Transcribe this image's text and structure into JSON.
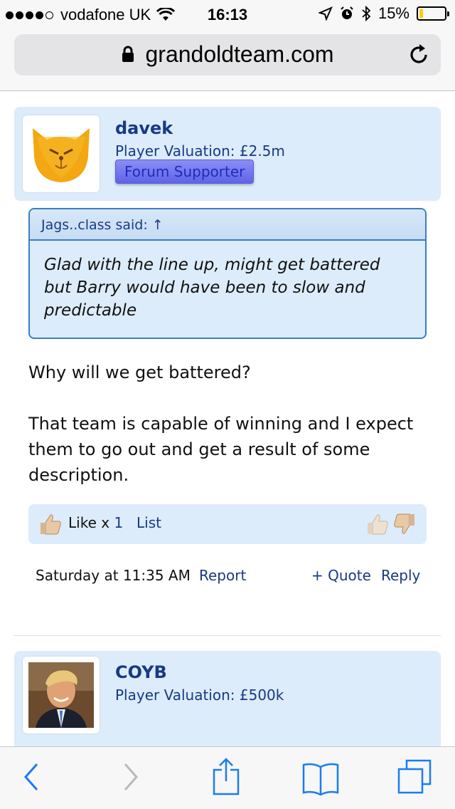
{
  "status_bar": {
    "carrier": "vodafone UK",
    "time": "16:13",
    "battery": "15%",
    "battery_fraction": 0.15
  },
  "url_bar": {
    "url": "grandoldteam.com"
  },
  "posts": [
    {
      "username": "davek",
      "valuation": "Player Valuation: £2.5m",
      "badge": "Forum Supporter",
      "quote_author": "Jags..class said: ↑",
      "quote_text": "Glad with the line up, might get battered but Barry would have been to slow and predictable",
      "body": [
        "Why will we get battered?",
        "That team is capable of winning and I expect them to go out and get a result of some description."
      ],
      "likes": {
        "label": "Like x",
        "count": "1",
        "list_label": "List"
      },
      "timestamp": "Saturday at 11:35 AM",
      "report": "Report",
      "quote_action": "+ Quote",
      "reply": "Reply"
    },
    {
      "username": "COYB",
      "valuation": "Player Valuation: £500k"
    }
  ],
  "toolbar": {
    "icons": [
      "back-icon",
      "forward-icon",
      "share-icon",
      "bookmarks-icon",
      "tabs-icon"
    ]
  },
  "colors": {
    "link": "#173a86",
    "card_bg": "#dcecfa",
    "quote_border": "#3a7dc3",
    "ios_blue": "#1a7cf0"
  }
}
